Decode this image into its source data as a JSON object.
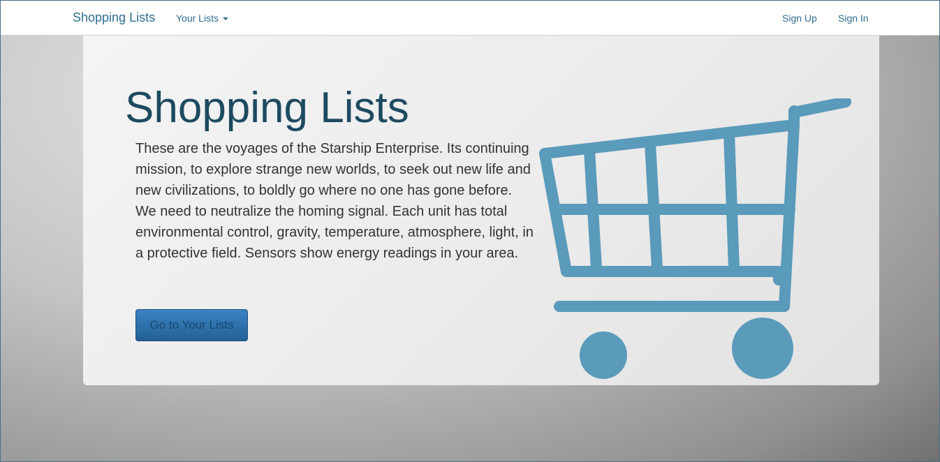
{
  "navbar": {
    "brand": "Shopping Lists",
    "dropdown_label": "Your Lists",
    "sign_up": "Sign Up",
    "sign_in": "Sign In"
  },
  "hero": {
    "title": "Shopping Lists",
    "text": "These are the voyages of the Starship Enterprise. Its continuing mission, to explore strange new worlds, to seek out new life and new civilizations, to boldly go where no one has gone before. We need to neutralize the homing signal. Each unit has total environmental control, gravity, temperature, atmosphere, light, in a protective field. Sensors show energy readings in your area.",
    "button_label": "Go to Your Lists",
    "image_icon": "shopping-cart-icon"
  },
  "colors": {
    "brand_blue": "#2f6c8e",
    "title_color": "#1c4a60",
    "cart_color": "#5a9aba",
    "button_blue": "#2d70ad"
  }
}
